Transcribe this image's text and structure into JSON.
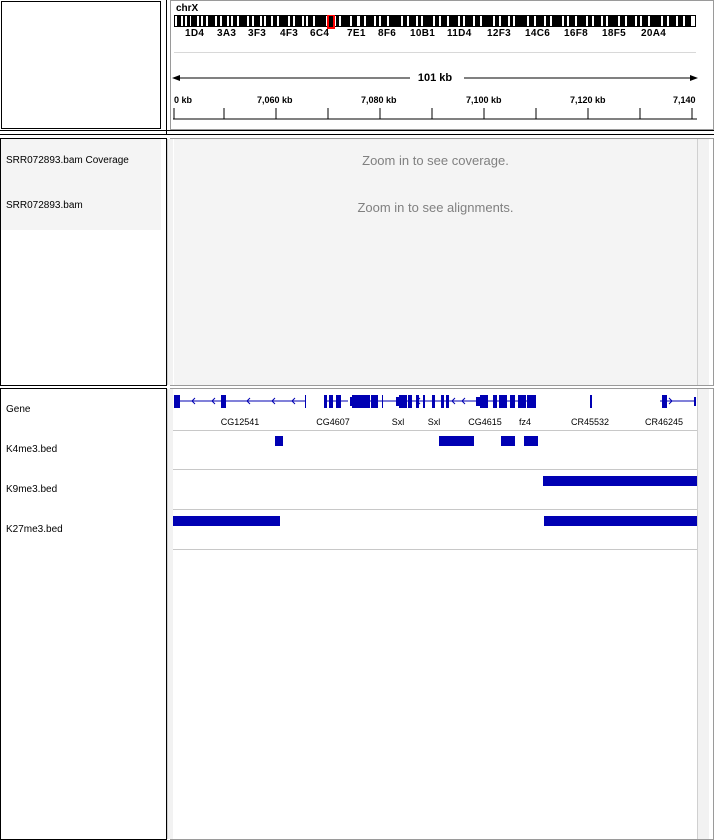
{
  "header": {
    "chromosome": "chrX",
    "cytobands": [
      "1D4",
      "3A3",
      "3F3",
      "4F3",
      "6C4",
      "7E1",
      "8F6",
      "10B1",
      "11D4",
      "12F3",
      "14C6",
      "16F8",
      "18F5",
      "20A4"
    ],
    "span_label": "101 kb",
    "ruler_ticks": [
      "0 kb",
      "7,060 kb",
      "7,080 kb",
      "7,100 kb",
      "7,120 kb",
      "7,140"
    ]
  },
  "data_panel": {
    "tracks": [
      {
        "name": "SRR072893.bam Coverage",
        "message": "Zoom in to see coverage."
      },
      {
        "name": "SRR072893.bam",
        "message": "Zoom in to see alignments."
      }
    ]
  },
  "feature_panel": {
    "gene_track": {
      "name": "Gene",
      "labels": [
        "CG12541",
        "CG4607",
        "Sxl",
        "Sxl",
        "CG4615",
        "fz4",
        "CR45532",
        "CR46245"
      ]
    },
    "bed_tracks": [
      {
        "name": "K4me3.bed"
      },
      {
        "name": "K9me3.bed"
      },
      {
        "name": "K27me3.bed"
      }
    ]
  },
  "colors": {
    "feature": "#0000b3",
    "ideogram_highlight": "#ff0000",
    "message": "#808080"
  }
}
